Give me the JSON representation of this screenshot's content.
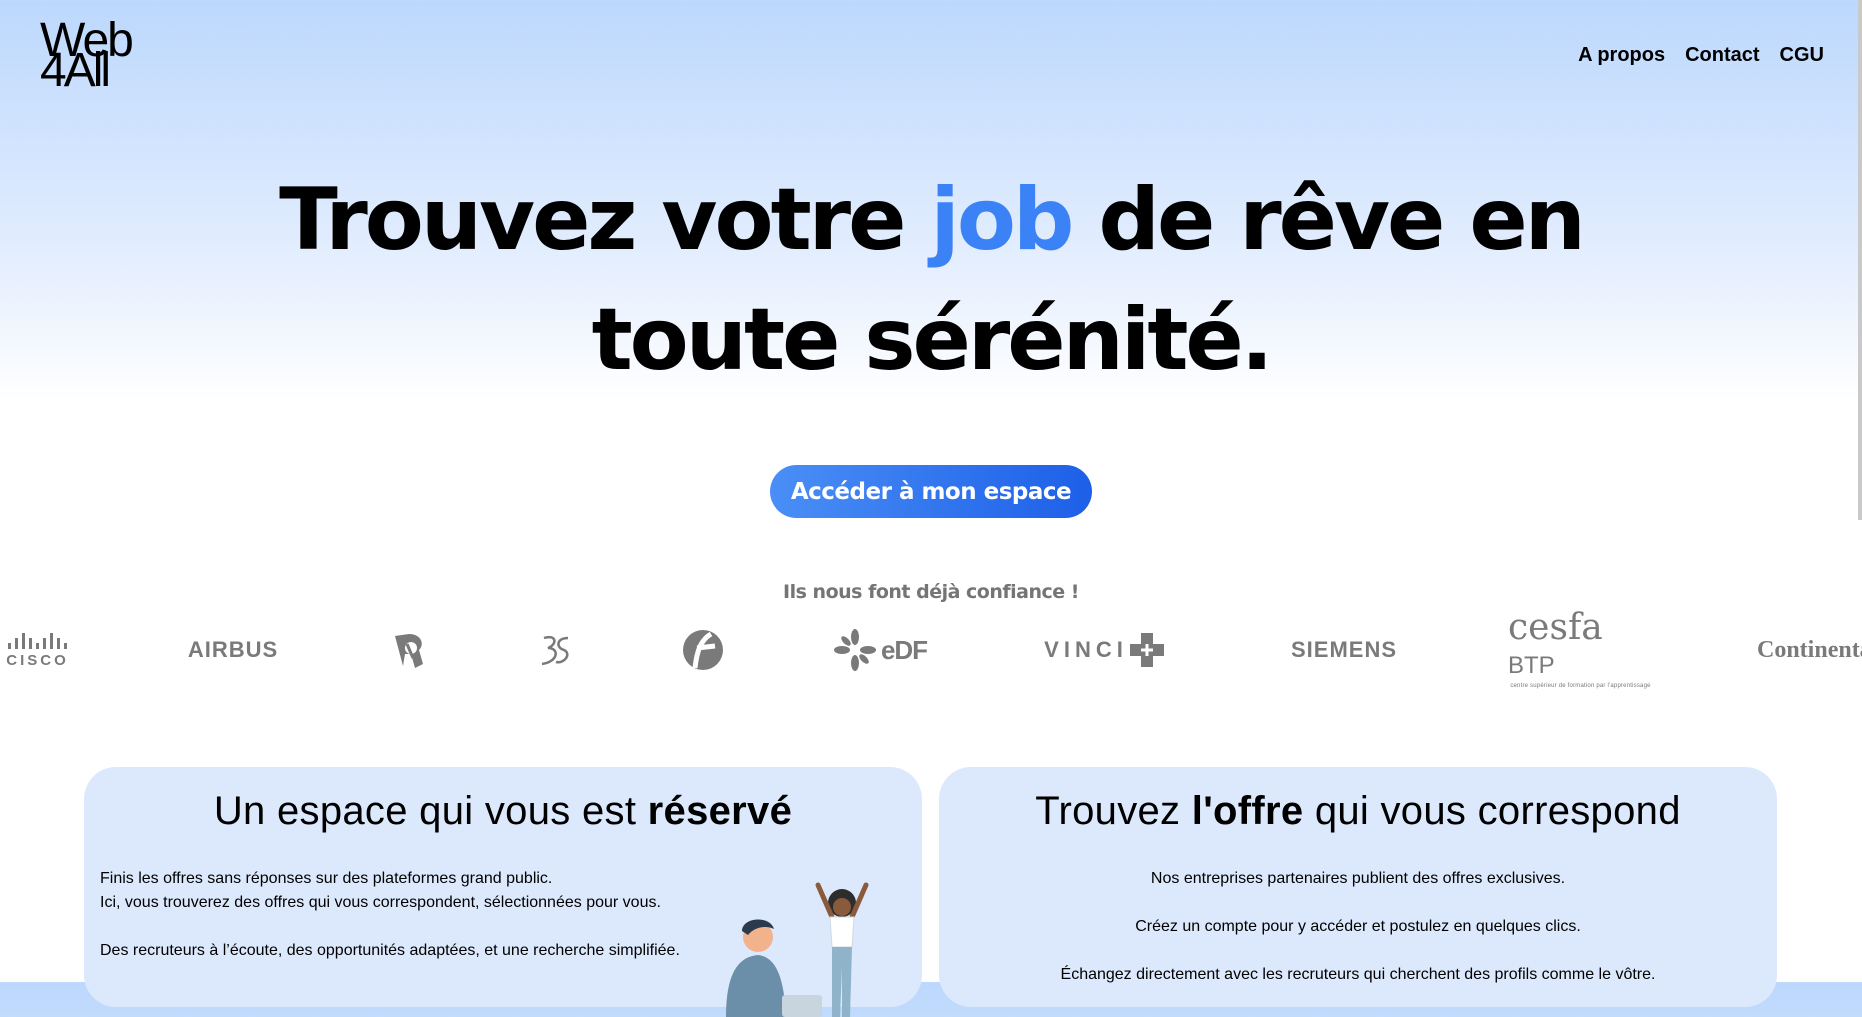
{
  "header": {
    "logo_line1": "Web",
    "logo_line2": "4All",
    "nav": [
      "A propos",
      "Contact",
      "CGU"
    ]
  },
  "hero": {
    "title_part1": "Trouvez votre ",
    "title_accent": "job",
    "title_part2": " de rêve en",
    "title_line2": "toute sérénité.",
    "accent_color": "#3b82f6"
  },
  "cta": {
    "label": "Accéder à mon espace"
  },
  "trust": {
    "heading": "Ils nous font déjà confiance !",
    "logos": {
      "cisco": "CISCO",
      "airbus": "AIRBUS",
      "edf": "eDF",
      "vinci": "VINCI",
      "siemens": "SIEMENS",
      "cesfa": "cesfa",
      "cesfa_suffix": "BTP",
      "cesfa_tagline": "centre supérieur de formation par l'apprentissage",
      "continental": "Continental"
    }
  },
  "card_left": {
    "title_part1": "Un espace qui vous est ",
    "title_bold": "réservé",
    "line1": "Finis les offres sans réponses sur des plateformes grand public.",
    "line2": "Ici, vous trouverez des offres qui vous correspondent, sélectionnées pour vous.",
    "line3": "Des recruteurs à l’écoute, des opportunités adaptées, et une recherche simplifiée."
  },
  "card_right": {
    "title_part1": "Trouvez ",
    "title_bold": "l'offre",
    "title_part2": " qui vous correspond",
    "line1": "Nos entreprises partenaires publient des offres exclusives.",
    "line2": "Créez un compte pour y accéder et postulez en quelques clics.",
    "line3": "Échangez directement avec les recruteurs qui cherchent des profils comme le vôtre."
  },
  "colors": {
    "cta_gradient_start": "#4a8ff6",
    "cta_gradient_end": "#1d5fe8",
    "card_bg": "#dce9fd",
    "logo_gray": "#7a7a7a"
  }
}
